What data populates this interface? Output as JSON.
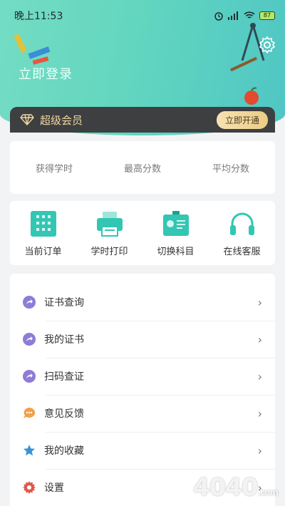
{
  "status_bar": {
    "time": "晚上11:53",
    "battery": "87"
  },
  "header": {
    "login_text": "立即登录"
  },
  "vip": {
    "label": "超级会员",
    "button": "立即开通"
  },
  "stats": [
    {
      "label": "获得学时"
    },
    {
      "label": "最高分数"
    },
    {
      "label": "平均分数"
    }
  ],
  "quick_actions": [
    {
      "label": "当前订单",
      "icon": "order-icon"
    },
    {
      "label": "学时打印",
      "icon": "printer-icon"
    },
    {
      "label": "切换科目",
      "icon": "id-card-icon"
    },
    {
      "label": "在线客服",
      "icon": "headphones-icon"
    }
  ],
  "menu": [
    {
      "label": "证书查询",
      "icon": "share-icon",
      "color": "#8e7cd6"
    },
    {
      "label": "我的证书",
      "icon": "share-icon",
      "color": "#8e7cd6"
    },
    {
      "label": "扫码查证",
      "icon": "share-icon",
      "color": "#8e7cd6"
    },
    {
      "label": "意见反馈",
      "icon": "chat-icon",
      "color": "#f0a14a"
    },
    {
      "label": "我的收藏",
      "icon": "star-icon",
      "color": "#3a93d8"
    },
    {
      "label": "设置",
      "icon": "gear-icon",
      "color": "#e0574c"
    }
  ],
  "watermark": {
    "text": "4040",
    "suffix": ".com"
  },
  "colors": {
    "accent": "#5fd3bd",
    "vip_bg": "#3d3f41",
    "vip_gold": "#eccb85"
  }
}
